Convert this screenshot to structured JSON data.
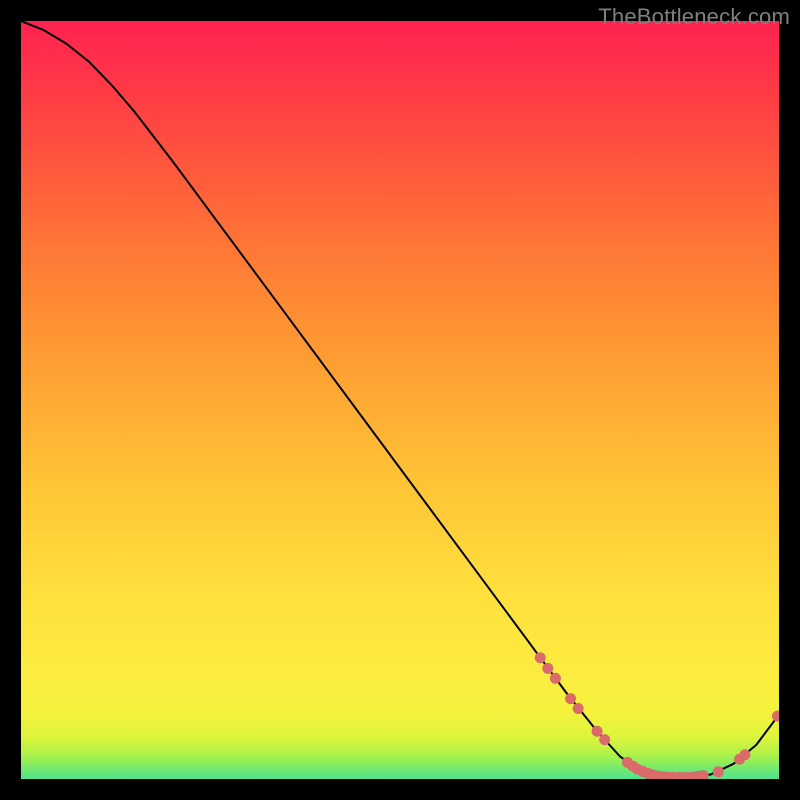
{
  "watermark": "TheBottleneck.com",
  "chart_data": {
    "type": "line",
    "title": "",
    "xlabel": "",
    "ylabel": "",
    "xlim": [
      0,
      100
    ],
    "ylim": [
      0,
      100
    ],
    "curve": [
      {
        "x": 0.0,
        "y": 100.0
      },
      {
        "x": 3.0,
        "y": 98.8
      },
      {
        "x": 6.0,
        "y": 97.0
      },
      {
        "x": 9.0,
        "y": 94.6
      },
      {
        "x": 12.0,
        "y": 91.5
      },
      {
        "x": 15.0,
        "y": 88.0
      },
      {
        "x": 20.0,
        "y": 81.5
      },
      {
        "x": 30.0,
        "y": 68.0
      },
      {
        "x": 40.0,
        "y": 54.5
      },
      {
        "x": 50.0,
        "y": 41.0
      },
      {
        "x": 60.0,
        "y": 27.5
      },
      {
        "x": 68.0,
        "y": 16.7
      },
      {
        "x": 72.0,
        "y": 11.3
      },
      {
        "x": 76.0,
        "y": 6.3
      },
      {
        "x": 79.0,
        "y": 3.0
      },
      {
        "x": 81.5,
        "y": 1.2
      },
      {
        "x": 84.0,
        "y": 0.35
      },
      {
        "x": 88.0,
        "y": 0.2
      },
      {
        "x": 91.0,
        "y": 0.6
      },
      {
        "x": 94.0,
        "y": 2.0
      },
      {
        "x": 97.0,
        "y": 4.5
      },
      {
        "x": 100.0,
        "y": 8.5
      }
    ],
    "markers": [
      {
        "x": 68.5,
        "y": 16.0
      },
      {
        "x": 69.5,
        "y": 14.6
      },
      {
        "x": 70.5,
        "y": 13.3
      },
      {
        "x": 72.5,
        "y": 10.6
      },
      {
        "x": 73.5,
        "y": 9.3
      },
      {
        "x": 76.0,
        "y": 6.3
      },
      {
        "x": 77.0,
        "y": 5.2
      },
      {
        "x": 80.0,
        "y": 2.2
      },
      {
        "x": 80.7,
        "y": 1.7
      },
      {
        "x": 81.3,
        "y": 1.3
      },
      {
        "x": 82.0,
        "y": 1.0
      },
      {
        "x": 82.7,
        "y": 0.75
      },
      {
        "x": 83.3,
        "y": 0.55
      },
      {
        "x": 84.0,
        "y": 0.4
      },
      {
        "x": 84.7,
        "y": 0.3
      },
      {
        "x": 85.3,
        "y": 0.25
      },
      {
        "x": 86.0,
        "y": 0.22
      },
      {
        "x": 86.7,
        "y": 0.2
      },
      {
        "x": 87.3,
        "y": 0.2
      },
      {
        "x": 88.0,
        "y": 0.2
      },
      {
        "x": 88.7,
        "y": 0.25
      },
      {
        "x": 89.3,
        "y": 0.35
      },
      {
        "x": 90.0,
        "y": 0.45
      },
      {
        "x": 92.0,
        "y": 0.95
      },
      {
        "x": 94.8,
        "y": 2.6
      },
      {
        "x": 95.5,
        "y": 3.2
      },
      {
        "x": 99.8,
        "y": 8.3
      }
    ],
    "gradient_stops": [
      {
        "offset": 0.0,
        "color": "#50e28e"
      },
      {
        "offset": 0.012,
        "color": "#6de973"
      },
      {
        "offset": 0.022,
        "color": "#8fee5b"
      },
      {
        "offset": 0.035,
        "color": "#b6f247"
      },
      {
        "offset": 0.055,
        "color": "#ddf43c"
      },
      {
        "offset": 0.085,
        "color": "#f3f23d"
      },
      {
        "offset": 0.14,
        "color": "#fdec3f"
      },
      {
        "offset": 0.25,
        "color": "#ffdf3d"
      },
      {
        "offset": 0.4,
        "color": "#ffc236"
      },
      {
        "offset": 0.55,
        "color": "#ff9e33"
      },
      {
        "offset": 0.7,
        "color": "#ff7736"
      },
      {
        "offset": 0.82,
        "color": "#ff543e"
      },
      {
        "offset": 0.92,
        "color": "#ff3747"
      },
      {
        "offset": 1.0,
        "color": "#ff2250"
      }
    ],
    "marker_color": "#d96b6b",
    "line_color": "#000000"
  }
}
